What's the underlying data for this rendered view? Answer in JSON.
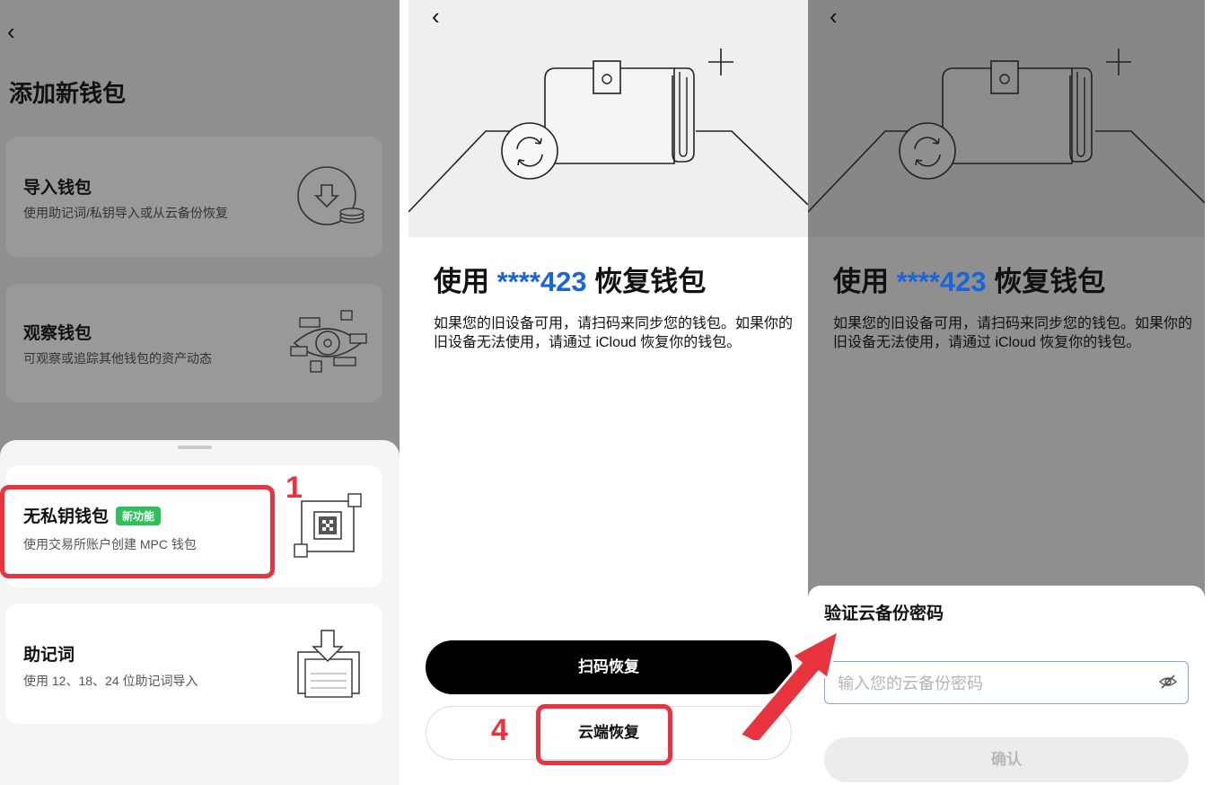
{
  "add_wallet_screen": {
    "back_label": "‹",
    "title": "添加新钱包",
    "options": [
      {
        "title": "导入钱包",
        "subtitle": "使用助记词/私钥导入或从云备份恢复",
        "icon": "download-coin-icon"
      },
      {
        "title": "观察钱包",
        "subtitle": "可观察或追踪其他钱包的资产动态",
        "icon": "eye-watch-icon"
      }
    ],
    "sheet": {
      "keyless": {
        "title": "无私钥钱包",
        "badge": "新功能",
        "subtitle": "使用交易所账户创建 MPC 钱包",
        "icon": "mpc-qr-icon"
      },
      "mnemonic": {
        "title": "助记词",
        "subtitle": "使用 12、18、24 位助记词导入",
        "icon": "import-document-icon"
      }
    },
    "step_label": "1"
  },
  "restore_screen": {
    "back_label": "‹",
    "title_prefix": "使用 ",
    "account_masked": "****423",
    "title_suffix": " 恢复钱包",
    "description": "如果您的旧设备可用，请扫码来同步您的钱包。如果你的旧设备无法使用，请通过 iCloud 恢复你的钱包。",
    "scan_button": "扫码恢复",
    "cloud_button": "云端恢复",
    "step_label": "4"
  },
  "verify_screen": {
    "back_label": "‹",
    "title_prefix": "使用 ",
    "account_masked": "****423",
    "title_suffix": " 恢复钱包",
    "description": "如果您的旧设备可用，请扫码来同步您的钱包。如果你的旧设备无法使用，请通过 iCloud 恢复你的钱包。",
    "dialog_title": "验证云备份密码",
    "password_placeholder": "输入您的云备份密码",
    "password_value": "",
    "confirm_button": "确认"
  },
  "colors": {
    "highlight": "#e8343f",
    "accent_blue": "#1a66d9",
    "badge_green": "#2fbf5b",
    "overlay_gray": "#8f8f8f"
  }
}
